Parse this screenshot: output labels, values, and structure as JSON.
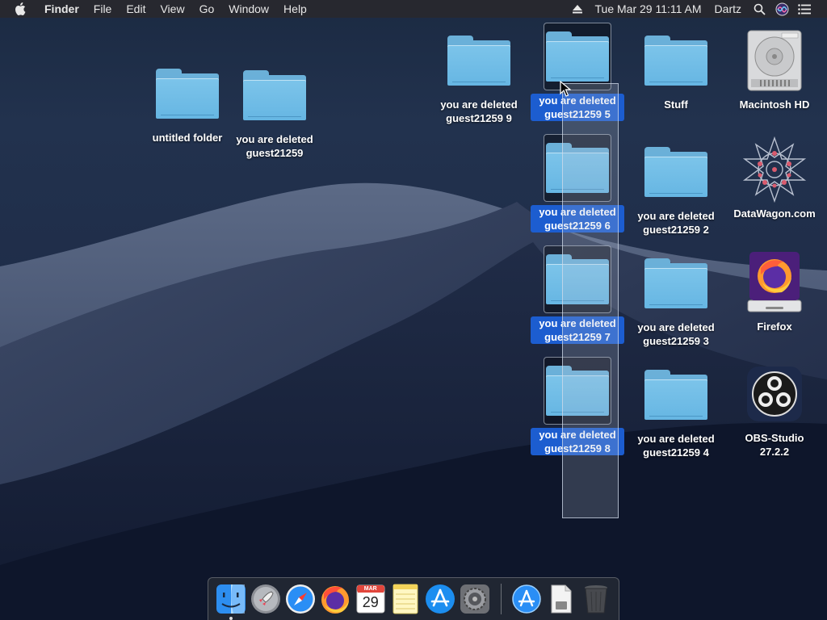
{
  "menubar": {
    "apple_icon": "apple-icon",
    "app_name": "Finder",
    "menus": [
      "File",
      "Edit",
      "View",
      "Go",
      "Window",
      "Help"
    ],
    "clock": "Tue Mar 29  11:11 AM",
    "user": "Dartz"
  },
  "desktop_icons": {
    "untitled_folder": "untitled folder",
    "deleted_plain": "you are deleted guest21259",
    "deleted_9": "you are deleted guest21259 9",
    "deleted_5": "you are deleted guest21259 5",
    "deleted_6": "you are deleted guest21259 6",
    "deleted_7": "you are deleted guest21259 7",
    "deleted_8": "you are deleted guest21259 8",
    "stuff": "Stuff",
    "deleted_2": "you are deleted guest21259 2",
    "deleted_3": "you are deleted guest21259 3",
    "deleted_4": "you are deleted guest21259 4",
    "macintosh_hd": "Macintosh HD",
    "datawagon": "DataWagon.com",
    "firefox": "Firefox",
    "obs": "OBS-Studio 27.2.2"
  },
  "dock": {
    "calendar_month": "MAR",
    "calendar_day": "29"
  },
  "colors": {
    "selection": "#1c5dd0",
    "folder": "#6ab0d9",
    "menubar": "#28282e"
  }
}
